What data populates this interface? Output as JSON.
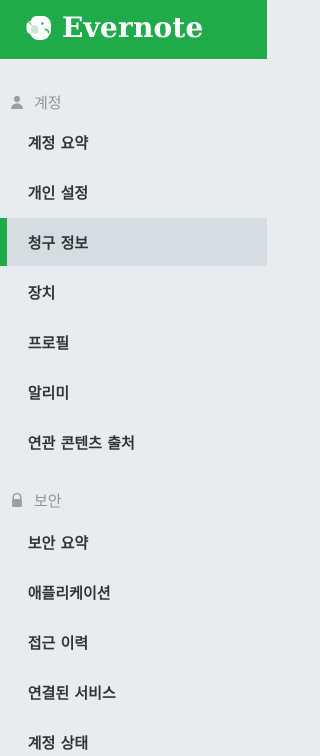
{
  "app": {
    "brand_name": "Evernote",
    "accent_color": "#1fab49"
  },
  "sections": [
    {
      "title": "계정",
      "icon": "user-icon",
      "items": [
        {
          "label": "계정 요약"
        },
        {
          "label": "개인 설정"
        },
        {
          "label": "청구 정보",
          "active": true
        },
        {
          "label": "장치"
        },
        {
          "label": "프로필"
        },
        {
          "label": "알리미"
        },
        {
          "label": "연관 콘텐츠 출처"
        }
      ]
    },
    {
      "title": "보안",
      "icon": "lock-icon",
      "items": [
        {
          "label": "보안 요약"
        },
        {
          "label": "애플리케이션"
        },
        {
          "label": "접근 이력"
        },
        {
          "label": "연결된 서비스"
        },
        {
          "label": "계정 상태"
        }
      ]
    }
  ]
}
